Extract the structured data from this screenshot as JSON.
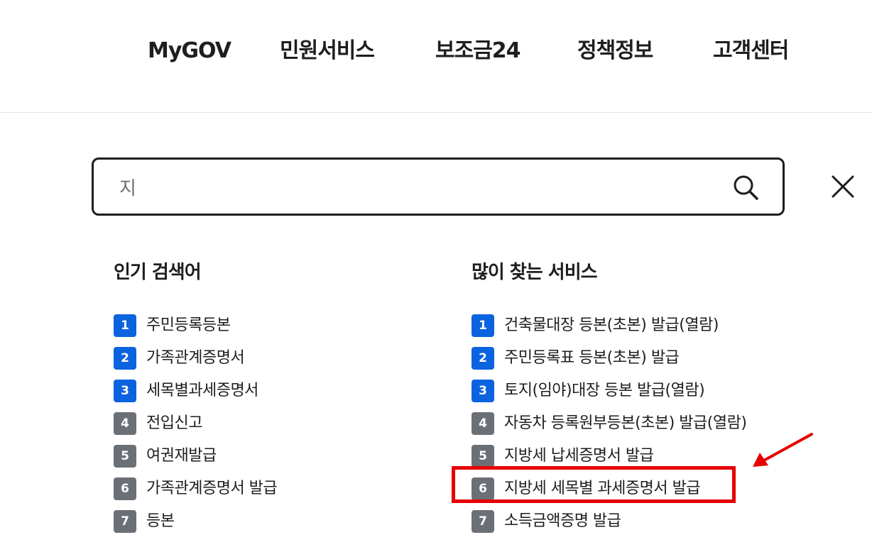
{
  "header": {
    "nav": [
      "MyGOV",
      "민원서비스",
      "보조금24",
      "정책정보",
      "고객센터"
    ]
  },
  "search": {
    "value": "지",
    "search_icon": "search-icon",
    "close_icon": "close-icon"
  },
  "popular": {
    "title": "인기 검색어",
    "items": [
      {
        "rank": "1",
        "label": "주민등록등본"
      },
      {
        "rank": "2",
        "label": "가족관계증명서"
      },
      {
        "rank": "3",
        "label": "세목별과세증명서"
      },
      {
        "rank": "4",
        "label": "전입신고"
      },
      {
        "rank": "5",
        "label": "여권재발급"
      },
      {
        "rank": "6",
        "label": "가족관계증명서 발급"
      },
      {
        "rank": "7",
        "label": "등본"
      }
    ]
  },
  "frequent": {
    "title": "많이 찾는 서비스",
    "items": [
      {
        "rank": "1",
        "label": "건축물대장 등본(초본) 발급(열람)"
      },
      {
        "rank": "2",
        "label": "주민등록표 등본(초본) 발급"
      },
      {
        "rank": "3",
        "label": "토지(임야)대장 등본 발급(열람)"
      },
      {
        "rank": "4",
        "label": "자동차 등록원부등본(초본) 발급(열람)"
      },
      {
        "rank": "5",
        "label": "지방세 납세증명서 발급"
      },
      {
        "rank": "6",
        "label": "지방세 세목별 과세증명서 발급"
      },
      {
        "rank": "7",
        "label": "소득금액증명 발급"
      }
    ]
  },
  "colors": {
    "rank_top": "#0b63e0",
    "rank_rest": "#6b6f76",
    "annotation": "#e60000"
  }
}
